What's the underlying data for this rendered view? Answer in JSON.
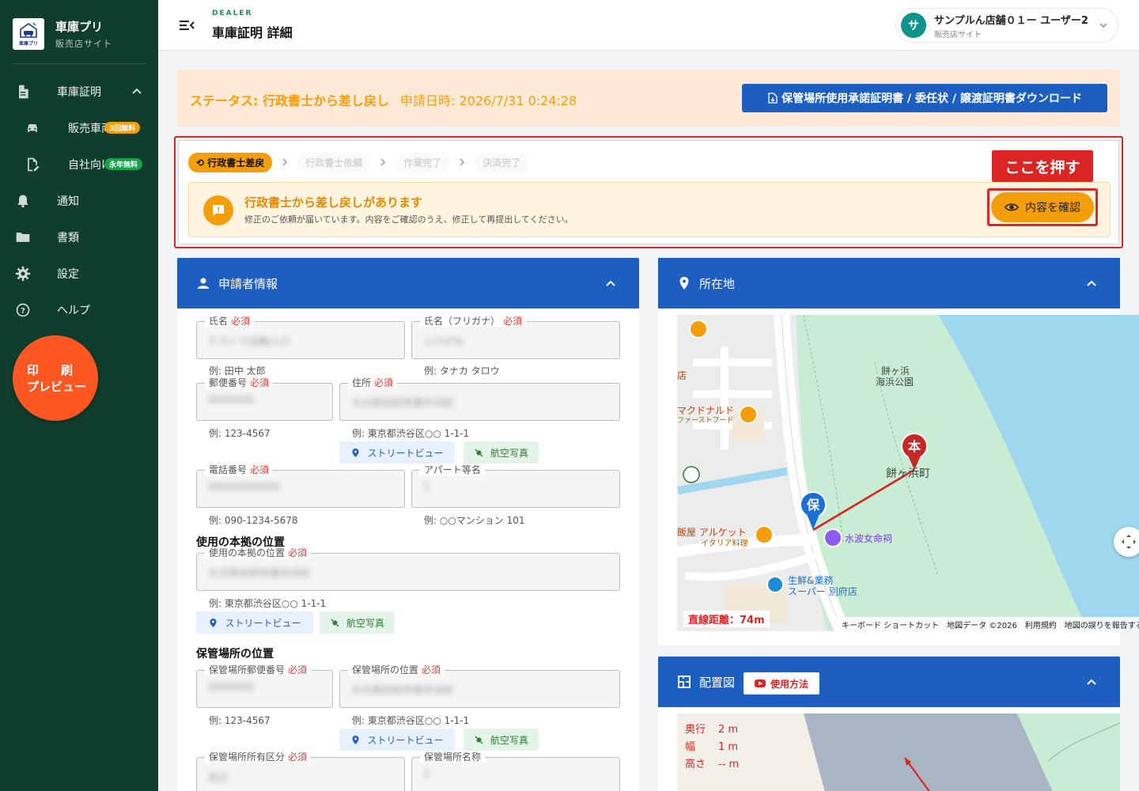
{
  "brand": {
    "name": "車庫プリ",
    "subtitle": "販売店サイト",
    "logo_text": "車庫プリ"
  },
  "sidebar": {
    "items": [
      {
        "label": "車庫証明",
        "icon": "document-icon",
        "expanded": true
      },
      {
        "label": "販売車両",
        "icon": "car-icon",
        "badge": "3回無料",
        "badge_color": "#f59e0b"
      },
      {
        "label": "自社向け",
        "icon": "edit-document-icon",
        "badge": "永年無料",
        "badge_color": "#16a34a"
      },
      {
        "label": "通知",
        "icon": "bell-icon"
      },
      {
        "label": "書類",
        "icon": "folder-icon"
      },
      {
        "label": "設定",
        "icon": "gear-icon"
      },
      {
        "label": "ヘルプ",
        "icon": "help-icon"
      }
    ],
    "print_button": {
      "line1": "印刷",
      "line2": "プレビュー"
    }
  },
  "header": {
    "section": "DEALER",
    "title": "車庫証明 詳細",
    "user": {
      "initial": "サ",
      "name": "サンプルん店舗０１ー ユーザー2",
      "role": "販売店サイト"
    }
  },
  "status": {
    "text": "ステータス: 行政書士から差し戻し",
    "date": "申請日時: 2026/7/31 0:24:28",
    "download_label": "保管場所使用承諾証明書 / 委任状 / 譲渡証明書ダウンロード"
  },
  "progress": {
    "steps": [
      {
        "label": "行政書士差戻",
        "active": true
      },
      {
        "label": "行政書士依頼",
        "active": false
      },
      {
        "label": "作業完了",
        "active": false
      },
      {
        "label": "決済完了",
        "active": false
      }
    ],
    "alert_title": "行政書士から差し戻しがあります",
    "alert_sub": "修正のご依頼が届いています。内容をご確認のうえ、修正して再提出してください。",
    "callout": "ここを押す",
    "confirm_label": "内容を確認"
  },
  "applicant": {
    "title": "申請者情報",
    "required": "必須",
    "fields": {
      "name": {
        "label": "氏名",
        "value": "テストマ自動入力",
        "hint": "例: 田中 太郎"
      },
      "kana": {
        "label": "氏名（フリガナ）",
        "value": "ふりがな",
        "hint": "例: タナカ タロウ"
      },
      "zip": {
        "label": "郵便番号",
        "value": "0000000",
        "hint": "例: 123-4567"
      },
      "address": {
        "label": "住所",
        "value": "大分県別府市東中浜町",
        "hint": "例: 東京都渋谷区○○ 1-1-1"
      },
      "phone": {
        "label": "電話番号",
        "value": "09000000000",
        "hint": "例: 090-1234-5678"
      },
      "apartment": {
        "label": "アパート等名",
        "value": "1",
        "hint": "例: ○○マンション 101"
      }
    },
    "base_section": "使用の本拠の位置",
    "base_field": {
      "label": "使用の本拠の位置",
      "value": "大分県別府市東中浜町",
      "hint": "例: 東京都渋谷区○○ 1-1-1"
    },
    "storage_section": "保管場所の位置",
    "storage_zip": {
      "label": "保管場所郵便番号",
      "value": "0000000",
      "hint": "例: 123-4567"
    },
    "storage_address": {
      "label": "保管場所の位置",
      "value": "大分県別府市東中浜町",
      "hint": "例: 東京都渋谷区○○ 1-1-1"
    },
    "ownership": {
      "label": "保管場所所有区分",
      "value": "自己"
    },
    "storage_name": {
      "label": "保管場所名称",
      "value": "1"
    },
    "street_view": "ストリートビュー",
    "aerial": "航空写真"
  },
  "location": {
    "title": "所在地",
    "map_labels": {
      "park_line1": "餅ヶ浜",
      "park_line2": "海浜公園",
      "town": "餅ヶ浜町",
      "mcd_line1": "マクドナルド",
      "mcd_line2": "ファーストフード",
      "shrine": "水波女命祠",
      "shop_left": "店",
      "restaurant_line1": "飯屋 アルケット",
      "restaurant_line2": "イタリア料理",
      "super_line1": "生鮮&業務",
      "super_line2": "スーパー 別府店",
      "pin_home": "本",
      "pin_storage": "保"
    },
    "distance": "直線距離：74m",
    "footer": "キーボード ショートカット　地図データ ©2026　利用規約　地図の誤りを報告する"
  },
  "layout_card": {
    "title": "配置図",
    "howto": "使用方法",
    "dims": [
      {
        "key": "奥行",
        "value": "2 m"
      },
      {
        "key": "幅",
        "value": "1 m"
      },
      {
        "key": "高さ",
        "value": "-- m"
      }
    ]
  }
}
